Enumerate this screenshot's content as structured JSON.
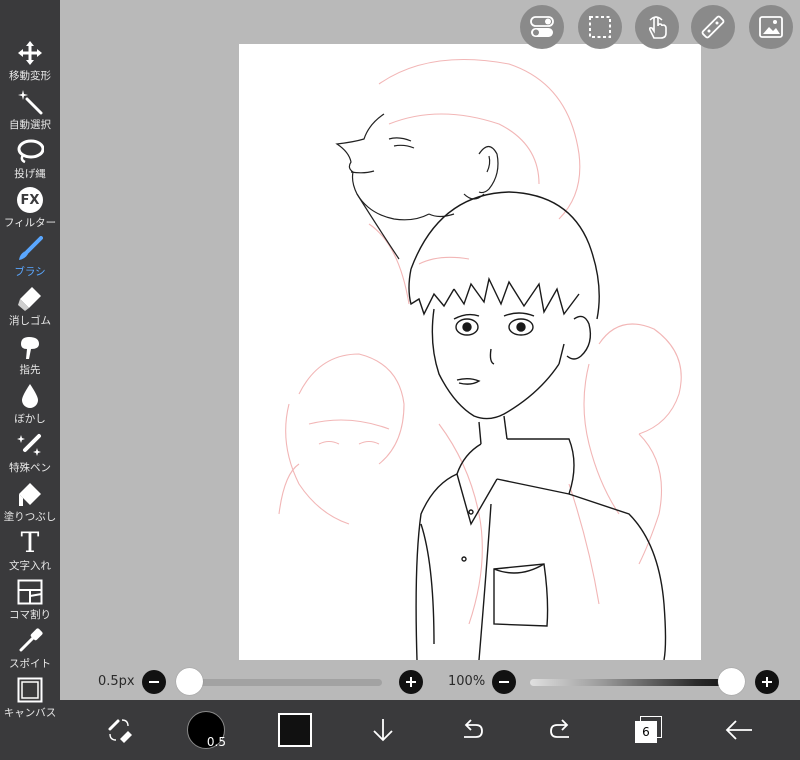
{
  "tools": [
    {
      "label": "移動変形",
      "icon": "move-icon"
    },
    {
      "label": "自動選択",
      "icon": "magic-wand-icon"
    },
    {
      "label": "投げ縄",
      "icon": "lasso-icon"
    },
    {
      "label": "フィルター",
      "icon": "fx-icon",
      "icon_text": "FX"
    },
    {
      "label": "ブラシ",
      "icon": "brush-icon",
      "active": true
    },
    {
      "label": "消しゴム",
      "icon": "eraser-icon"
    },
    {
      "label": "指先",
      "icon": "finger-smudge-icon"
    },
    {
      "label": "ぼかし",
      "icon": "blur-drop-icon"
    },
    {
      "label": "特殊ペン",
      "icon": "special-pen-icon"
    },
    {
      "label": "塗りつぶし",
      "icon": "fill-bucket-icon"
    },
    {
      "label": "文字入れ",
      "icon": "text-tool-icon",
      "icon_text": "T"
    },
    {
      "label": "コマ割り",
      "icon": "frame-divider-icon"
    },
    {
      "label": "スポイト",
      "icon": "eyedropper-icon"
    },
    {
      "label": "キャンバス",
      "icon": "canvas-icon"
    }
  ],
  "top_buttons": [
    "toggle-icon",
    "selection-icon",
    "hand-gesture-icon",
    "ruler-icon",
    "image-icon"
  ],
  "brush": {
    "size_label": "0.5px",
    "size_fraction": 0.0,
    "opacity_label": "100%",
    "opacity_fraction": 1.0
  },
  "bottom": {
    "brush_size_badge": "0.5",
    "current_color": "#111111",
    "layer_count": "6"
  },
  "colors": {
    "sidebar_bg": "#3a3a3c",
    "active_tool": "#5aa7ff",
    "workspace_bg": "#b9b9b9",
    "sketch_line": "#222222",
    "draft_line": "#f2b6b6"
  }
}
